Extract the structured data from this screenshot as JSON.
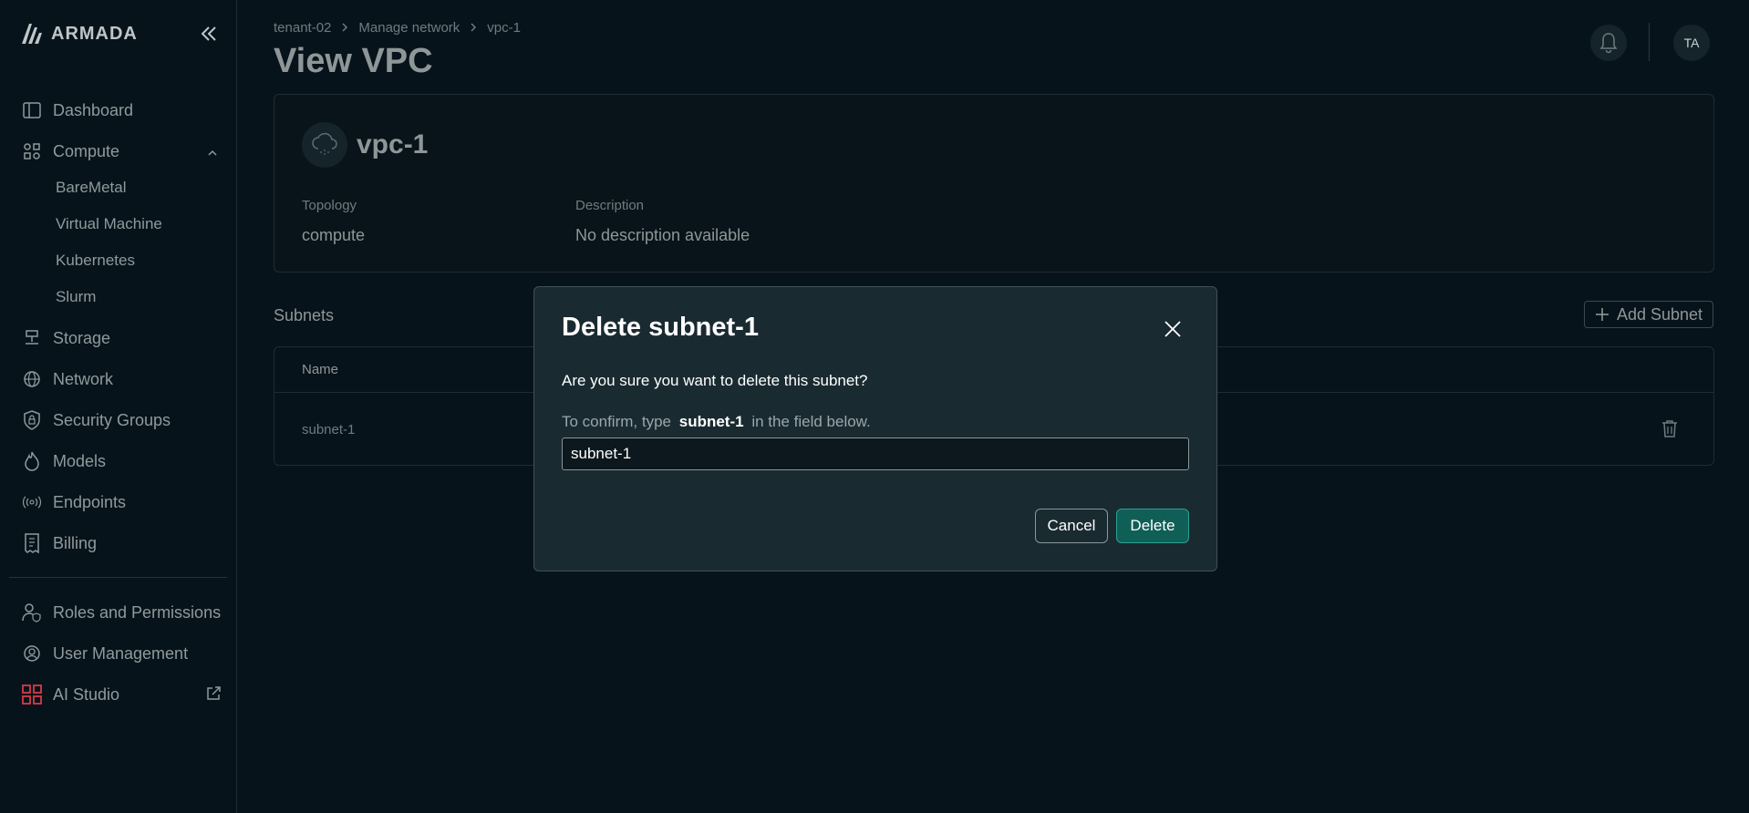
{
  "app": {
    "brand": "ARMADA"
  },
  "sidebar": {
    "items": [
      {
        "label": "Dashboard",
        "icon": "dashboard-icon"
      },
      {
        "label": "Compute",
        "icon": "compute-icon"
      },
      {
        "label": "BareMetal"
      },
      {
        "label": "Virtual Machine"
      },
      {
        "label": "Kubernetes"
      },
      {
        "label": "Slurm"
      },
      {
        "label": "Storage",
        "icon": "storage-icon"
      },
      {
        "label": "Network",
        "icon": "globe-icon"
      },
      {
        "label": "Security Groups",
        "icon": "shield-lock-icon"
      },
      {
        "label": "Models",
        "icon": "flame-icon"
      },
      {
        "label": "Endpoints",
        "icon": "broadcast-icon"
      },
      {
        "label": "Billing",
        "icon": "receipt-icon"
      },
      {
        "label": "Roles and Permissions",
        "icon": "user-shield-icon"
      },
      {
        "label": "User Management",
        "icon": "user-gear-icon"
      },
      {
        "label": "AI Studio",
        "icon": "grid-apps-icon"
      }
    ]
  },
  "header": {
    "breadcrumb": [
      "tenant-02",
      "Manage network",
      "vpc-1"
    ],
    "title": "View VPC",
    "avatar_initials": "TA"
  },
  "vpc": {
    "name": "vpc-1",
    "topology_label": "Topology",
    "topology_value": "compute",
    "description_label": "Description",
    "description_value": "No description available"
  },
  "subnets": {
    "title": "Subnets",
    "add_button": "Add Subnet",
    "columns": [
      "Name"
    ],
    "rows": [
      {
        "name": "subnet-1"
      }
    ]
  },
  "modal": {
    "title": "Delete subnet-1",
    "question": "Are you sure you want to delete this subnet?",
    "confirm_prefix": "To confirm, type",
    "confirm_name": "subnet-1",
    "confirm_suffix": "in the field below.",
    "input_value": "subnet-1",
    "cancel_label": "Cancel",
    "delete_label": "Delete"
  },
  "colors": {
    "background": "#07131a",
    "modal_bg": "#1a2a31",
    "delete_button": "#0f5f57",
    "ai_studio_red": "#d63b4a"
  }
}
